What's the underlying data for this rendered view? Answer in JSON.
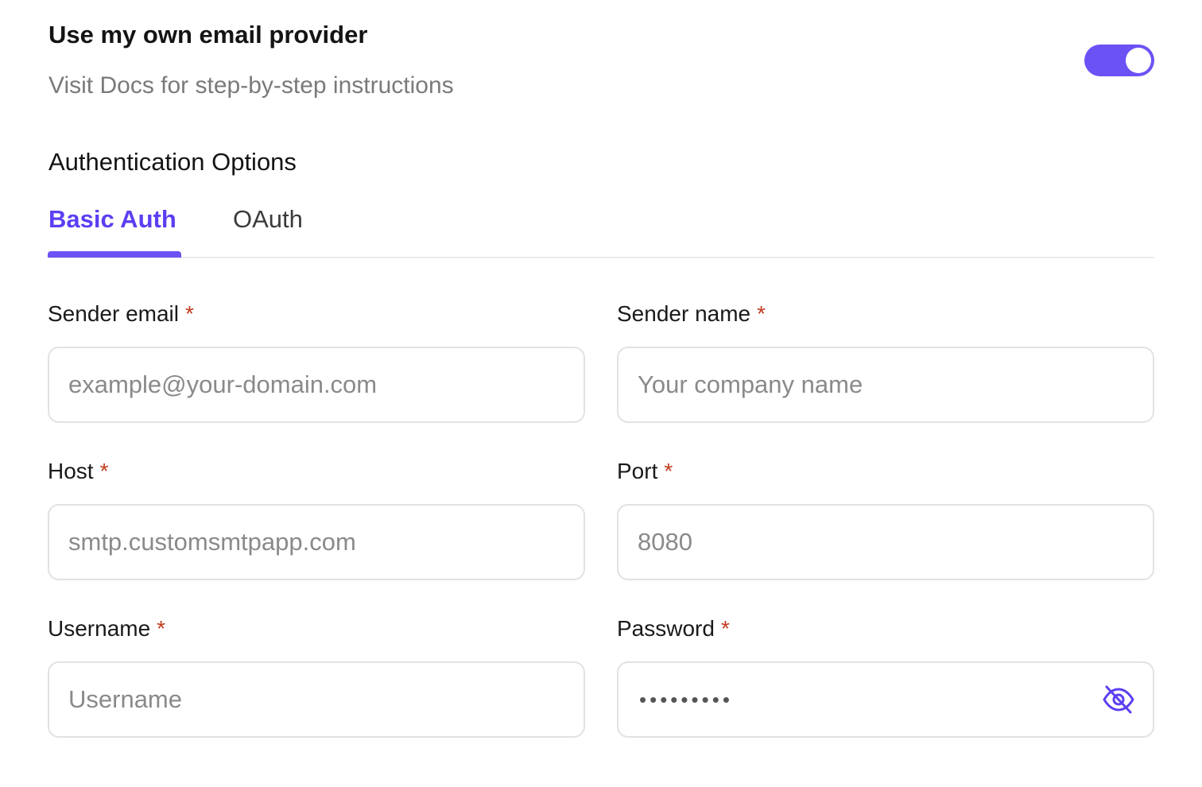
{
  "provider": {
    "title": "Use my own email provider",
    "subtitle": "Visit Docs for step-by-step instructions",
    "toggle_on": true,
    "accent_color": "#6b52f5"
  },
  "auth": {
    "heading": "Authentication Options",
    "tabs": [
      {
        "label": "Basic Auth",
        "active": true
      },
      {
        "label": "OAuth",
        "active": false
      }
    ]
  },
  "fields": {
    "sender_email": {
      "label": "Sender email",
      "required": "*",
      "placeholder": "example@your-domain.com"
    },
    "sender_name": {
      "label": "Sender name",
      "required": "*",
      "placeholder": "Your company name"
    },
    "host": {
      "label": "Host",
      "required": "*",
      "placeholder": "smtp.customsmtpapp.com"
    },
    "port": {
      "label": "Port",
      "required": "*",
      "placeholder": "8080"
    },
    "username": {
      "label": "Username",
      "required": "*",
      "placeholder": "Username"
    },
    "password": {
      "label": "Password",
      "required": "*",
      "masked_value": "•••••••••",
      "icon": "eye-off-icon"
    }
  }
}
